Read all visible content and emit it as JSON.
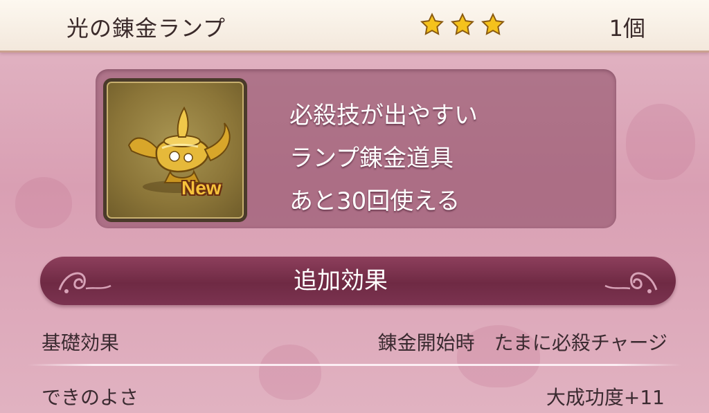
{
  "header": {
    "item_name": "光の錬金ランプ",
    "rarity_stars": 3,
    "quantity": "1個"
  },
  "item": {
    "icon": "golden-magic-lamp-icon",
    "badge": "New",
    "description_lines": [
      "必殺技が出やすい",
      "ランプ錬金道具",
      "あと30回使える"
    ]
  },
  "effects_section": {
    "title": "追加効果"
  },
  "rows": [
    {
      "label": "基礎効果",
      "value": "錬金開始時　たまに必殺チャージ"
    },
    {
      "label": "できのよさ",
      "value": "大成功度+11"
    }
  ],
  "colors": {
    "background": "#dba4b7",
    "header": "#f8f0e6",
    "banner": "#7b3350",
    "star": "#f5c21c",
    "badge": "#f6c23b"
  }
}
